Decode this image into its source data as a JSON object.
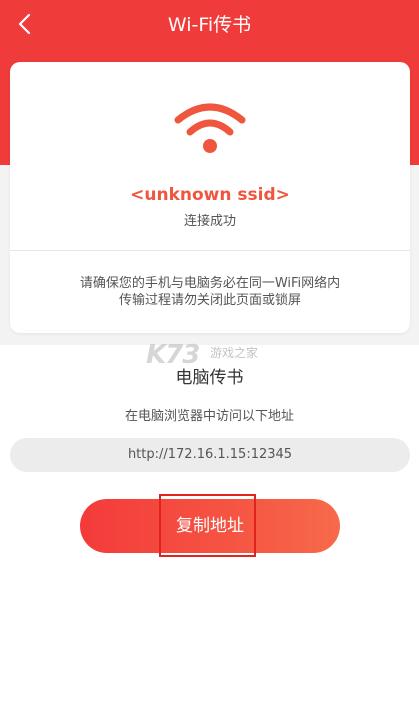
{
  "header": {
    "title": "Wi-Fi传书",
    "back_icon": "chevron-left-icon",
    "bg_color": "#ef3b39"
  },
  "card": {
    "wifi_icon": "wifi-icon",
    "wifi_icon_color": "#f0553d",
    "ssid": "<unknown ssid>",
    "status": "连接成功",
    "notice_line1": "请确保您的手机与电脑务必在同一WiFi网络内",
    "notice_line2": "传输过程请勿关闭此页面或锁屏"
  },
  "watermark": {
    "logo": "K73",
    "text": "游戏之家"
  },
  "main": {
    "section_title": "电脑传书",
    "instruction": "在电脑浏览器中访问以下地址",
    "address": "http://172.16.1.15:12345",
    "copy_button_label": "复制地址",
    "accent_color": "#f33b3a"
  }
}
